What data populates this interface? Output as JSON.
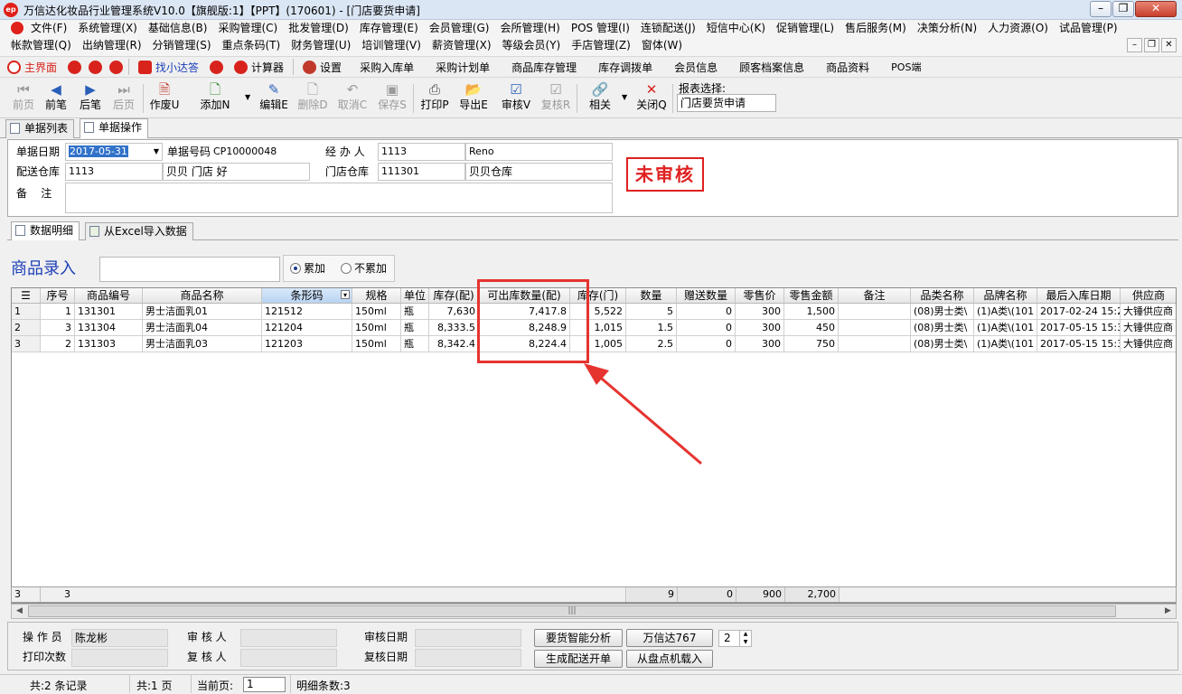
{
  "window": {
    "title": "万信达化妆品行业管理系统V10.0【旗舰版:1】【PPT】(170601) - [门店要货申请]",
    "logo_text": "ep"
  },
  "menu": {
    "row1": [
      "文件(F)",
      "系统管理(X)",
      "基础信息(B)",
      "采购管理(C)",
      "批发管理(D)",
      "库存管理(E)",
      "会员管理(G)",
      "会所管理(H)",
      "POS 管理(I)",
      "连锁配送(J)",
      "短信中心(K)",
      "促销管理(L)",
      "售后服务(M)",
      "决策分析(N)",
      "人力资源(O)",
      "试品管理(P)"
    ],
    "row2": [
      "帐款管理(Q)",
      "出纳管理(R)",
      "分销管理(S)",
      "重点条码(T)",
      "财务管理(U)",
      "培训管理(V)",
      "薪资管理(X)",
      "等级会员(Y)",
      "手店管理(Z)",
      "窗体(W)"
    ]
  },
  "quickbar": {
    "items": [
      "主界面",
      "找小达答",
      "计算器",
      "设置",
      "采购入库单",
      "采购计划单",
      "商品库存管理",
      "库存调拨单",
      "会员信息",
      "顾客档案信息",
      "商品资料",
      "POS端"
    ]
  },
  "toolbar": {
    "first": "前页",
    "prev": "前笔",
    "next": "后笔",
    "last": "后页",
    "void": "作废U",
    "add": "添加N",
    "edit": "编辑E",
    "delete": "删除D",
    "cancel": "取消C",
    "save": "保存S",
    "print": "打印P",
    "export": "导出E",
    "audit": "审核V",
    "reaudit": "复核R",
    "related": "相关",
    "close": "关闭Q",
    "report_label": "报表选择:",
    "report_value": "门店要货申请"
  },
  "tabs": {
    "list": "单据列表",
    "operation": "单据操作"
  },
  "header": {
    "date_label": "单据日期",
    "date_value": "2017-05-31",
    "no_label": "单据号码",
    "no_value": "CP10000048",
    "handler_label": "经 办 人",
    "handler_code": "1113",
    "handler_name": "Reno",
    "ship_wh_label": "配送仓库",
    "ship_wh_code": "1113",
    "ship_wh_name": "贝贝 门店 好",
    "store_wh_label": "门店仓库",
    "store_wh_code": "111301",
    "store_wh_name": "贝贝仓库",
    "remark_label": "备    注",
    "remark_value": "",
    "status": "未审核"
  },
  "detail_tabs": {
    "detail": "数据明细",
    "excel": "从Excel导入数据"
  },
  "entry": {
    "label": "商品录入",
    "mode_add": "累加",
    "mode_noadd": "不累加",
    "mode_selected": "累加"
  },
  "grid": {
    "columns": [
      "序号",
      "商品编号",
      "商品名称",
      "条形码",
      "规格",
      "单位",
      "库存(配)",
      "可出库数量(配)",
      "库存(门)",
      "数量",
      "赠送数量",
      "零售价",
      "零售金额",
      "备注",
      "品类名称",
      "品牌名称",
      "最后入库日期",
      "供应商"
    ],
    "rows": [
      [
        "1",
        "1",
        "131301",
        "男士洁面乳01",
        "121512",
        "150ml",
        "瓶",
        "7,630",
        "7,417.8",
        "5,522",
        "5",
        "0",
        "300",
        "1,500",
        "",
        "(08)男士类\\",
        "(1)A类\\(101",
        "2017-02-24 15:2",
        "大锤供应商"
      ],
      [
        "2",
        "3",
        "131304",
        "男士洁面乳04",
        "121204",
        "150ml",
        "瓶",
        "8,333.5",
        "8,248.9",
        "1,015",
        "1.5",
        "0",
        "300",
        "450",
        "",
        "(08)男士类\\",
        "(1)A类\\(101",
        "2017-05-15 15:3",
        "大锤供应商"
      ],
      [
        "3",
        "2",
        "131303",
        "男士洁面乳03",
        "121203",
        "150ml",
        "瓶",
        "8,342.4",
        "8,224.4",
        "1,005",
        "2.5",
        "0",
        "300",
        "750",
        "",
        "(08)男士类\\",
        "(1)A类\\(101",
        "2017-05-15 15:3",
        "大锤供应商"
      ]
    ],
    "footer": {
      "rowcount": "3",
      "count": "3",
      "qty": "9",
      "gift": "0",
      "price": "900",
      "amount": "2,700"
    }
  },
  "bottom": {
    "operator_label": "操 作 员",
    "operator_value": "陈龙彬",
    "auditor_label": "审 核 人",
    "audit_date_label": "审核日期",
    "print_count_label": "打印次数",
    "reviewer_label": "复 核 人",
    "review_date_label": "复核日期",
    "btn_analysis": "要货智能分析",
    "btn_wxd": "万信达767",
    "spinner_value": "2",
    "btn_generate": "生成配送开单",
    "btn_load": "从盘点机载入"
  },
  "status": {
    "records": "共:2 条记录",
    "pages": "共:1 页",
    "current_label": "当前页:",
    "current_value": "1",
    "detail_count": "明细条数:3"
  },
  "colors": {
    "stamp": "#e02020",
    "highlight": "#e5342f",
    "entry_label": "#1c3fb8"
  }
}
